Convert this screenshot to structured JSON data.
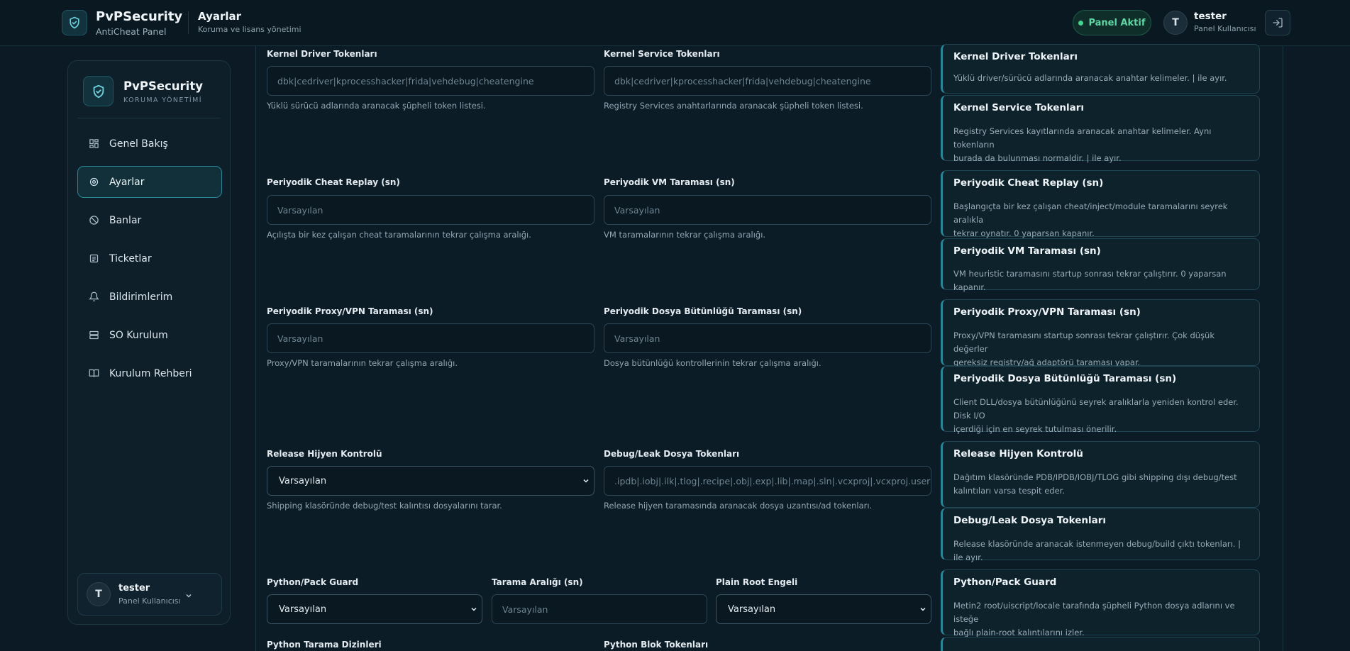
{
  "brand": {
    "title": "PvPSecurity",
    "subtitle": "AntiCheat Panel"
  },
  "header": {
    "title": "Ayarlar",
    "subtitle": "Koruma ve lisans yönetimi"
  },
  "status": {
    "label": "Panel Aktif",
    "color": "#46d38f"
  },
  "user": {
    "initial": "T",
    "name": "tester",
    "role": "Panel Kullanıcısı"
  },
  "sidebar": {
    "title": "PvPSecurity",
    "subtitle": "KORUMA YÖNETİMİ",
    "items": [
      {
        "label": "Genel Bakış",
        "icon": "dashboard-icon",
        "active": false
      },
      {
        "label": "Ayarlar",
        "icon": "gear-icon",
        "active": true
      },
      {
        "label": "Banlar",
        "icon": "ban-icon",
        "active": false
      },
      {
        "label": "Ticketlar",
        "icon": "ticket-icon",
        "active": false
      },
      {
        "label": "Bildirimlerim",
        "icon": "bell-icon",
        "active": false
      },
      {
        "label": "SO Kurulum",
        "icon": "server-icon",
        "active": false
      },
      {
        "label": "Kurulum Rehberi",
        "icon": "book-icon",
        "active": false
      }
    ]
  },
  "form": {
    "kernel_driver": {
      "label": "Kernel Driver Tokenları",
      "placeholder": "dbk|cedriver|kprocesshacker|frida|vehdebug|cheatengine",
      "help": "Yüklü sürücü adlarında aranacak şüpheli token listesi."
    },
    "kernel_service": {
      "label": "Kernel Service Tokenları",
      "placeholder": "dbk|cedriver|kprocesshacker|frida|vehdebug|cheatengine",
      "help": "Registry Services anahtarlarında aranacak şüpheli token listesi."
    },
    "cheat_replay": {
      "label": "Periyodik Cheat Replay (sn)",
      "placeholder": "Varsayılan",
      "help": "Açılışta bir kez çalışan cheat taramalarının tekrar çalışma aralığı."
    },
    "vm_scan": {
      "label": "Periyodik VM Taraması (sn)",
      "placeholder": "Varsayılan",
      "help": "VM taramalarının tekrar çalışma aralığı."
    },
    "proxy_scan": {
      "label": "Periyodik Proxy/VPN Taraması (sn)",
      "placeholder": "Varsayılan",
      "help": "Proxy/VPN taramalarının tekrar çalışma aralığı."
    },
    "file_integrity": {
      "label": "Periyodik Dosya Bütünlüğü Taraması (sn)",
      "placeholder": "Varsayılan",
      "help": "Dosya bütünlüğü kontrollerinin tekrar çalışma aralığı."
    },
    "release_hygiene": {
      "label": "Release Hijyen Kontrolü",
      "value": "Varsayılan",
      "help": "Shipping klasöründe debug/test kalıntısı dosyalarını tarar."
    },
    "debug_leak": {
      "label": "Debug/Leak Dosya Tokenları",
      "placeholder": ".ipdb|.iobj|.ilk|.tlog|.recipe|.obj|.exp|.lib|.map|.sln|.vcxproj|.vcxproj.user",
      "help": "Release hijyen taramasında aranacak dosya uzantısı/ad tokenları."
    },
    "python_guard": {
      "label": "Python/Pack Guard",
      "value": "Varsayılan"
    },
    "scan_interval": {
      "label": "Tarama Aralığı (sn)",
      "placeholder": "Varsayılan"
    },
    "plain_root": {
      "label": "Plain Root Engeli",
      "value": "Varsayılan"
    },
    "python_dirs": {
      "label": "Python Tarama Dizinleri"
    },
    "python_block": {
      "label": "Python Blok Tokenları"
    }
  },
  "info_cards": [
    {
      "title": "Kernel Driver Tokenları",
      "lines": [
        "Yüklü driver/sürücü adlarında aranacak anahtar kelimeler. | ile ayır."
      ]
    },
    {
      "title": "Kernel Service Tokenları",
      "lines": [
        "Registry Services kayıtlarında aranacak anahtar kelimeler. Aynı tokenların",
        "burada da bulunması normaldir. | ile ayır."
      ]
    },
    {
      "title": "Periyodik Cheat Replay (sn)",
      "lines": [
        "Başlangıçta bir kez çalışan cheat/inject/module taramalarını seyrek aralıkla",
        "tekrar oynatır. 0 yaparsan kapanır."
      ]
    },
    {
      "title": "Periyodik VM Taraması (sn)",
      "lines": [
        "VM heuristic taramasını startup sonrası tekrar çalıştırır. 0 yaparsan kapanır."
      ]
    },
    {
      "title": "Periyodik Proxy/VPN Taraması (sn)",
      "lines": [
        "Proxy/VPN taramasını startup sonrası tekrar çalıştırır. Çok düşük değerler",
        "gereksiz registry/ağ adaptörü taraması yapar."
      ]
    },
    {
      "title": "Periyodik Dosya Bütünlüğü Taraması (sn)",
      "lines": [
        "Client DLL/dosya bütünlüğünü seyrek aralıklarla yeniden kontrol eder. Disk I/O",
        "içerdiği için en seyrek tutulması önerilir."
      ]
    },
    {
      "title": "Release Hijyen Kontrolü",
      "lines": [
        "Dağıtım klasöründe PDB/IPDB/IOBJ/TLOG gibi shipping dışı debug/test",
        "kalıntıları varsa tespit eder."
      ]
    },
    {
      "title": "Debug/Leak Dosya Tokenları",
      "lines": [
        "Release klasöründe aranacak istenmeyen debug/build çıktı tokenları. | ile ayır."
      ]
    },
    {
      "title": "Python/Pack Guard",
      "lines": [
        "Metin2 root/uiscript/locale tarafında şüpheli Python dosya adlarını ve isteğe",
        "bağlı plain-root kalıntılarını izler."
      ]
    }
  ]
}
